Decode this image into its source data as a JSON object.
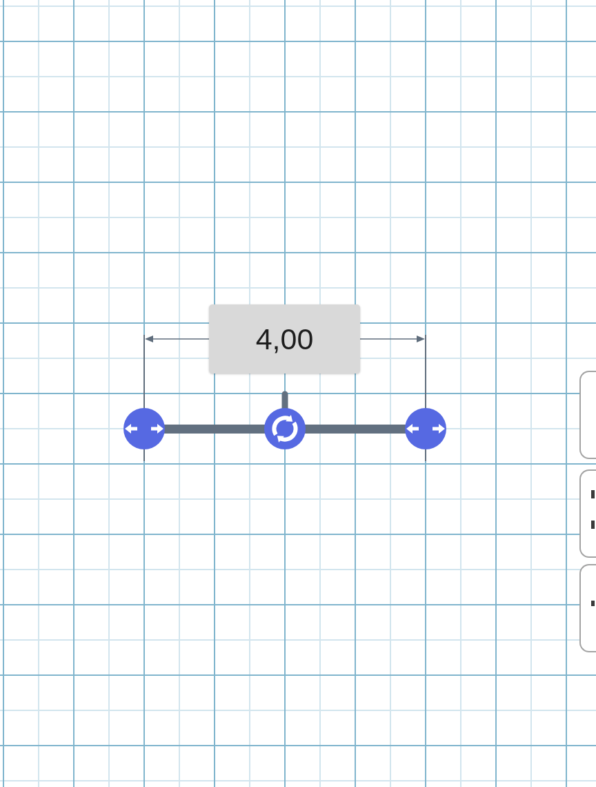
{
  "measurement": {
    "value": "4,00"
  },
  "segment": {
    "handles": [
      {
        "kind": "resize"
      },
      {
        "kind": "rotate"
      },
      {
        "kind": "resize"
      }
    ]
  }
}
